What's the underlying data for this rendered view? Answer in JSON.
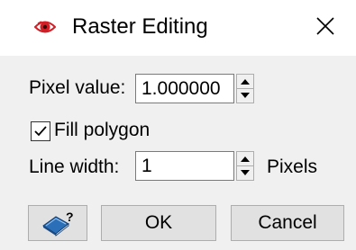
{
  "window": {
    "title": "Raster Editing",
    "close_glyph": "✕",
    "app_icon": "eye-icon",
    "accent_red": "#d21f26"
  },
  "form": {
    "pixel_value": {
      "label": "Pixel value:",
      "value": "1.000000"
    },
    "fill_polygon": {
      "label": "Fill polygon",
      "checked": true
    },
    "line_width": {
      "label": "Line width:",
      "value": "1",
      "unit": "Pixels"
    }
  },
  "footer": {
    "help_icon": "help-book-icon",
    "ok_label": "OK",
    "cancel_label": "Cancel"
  }
}
